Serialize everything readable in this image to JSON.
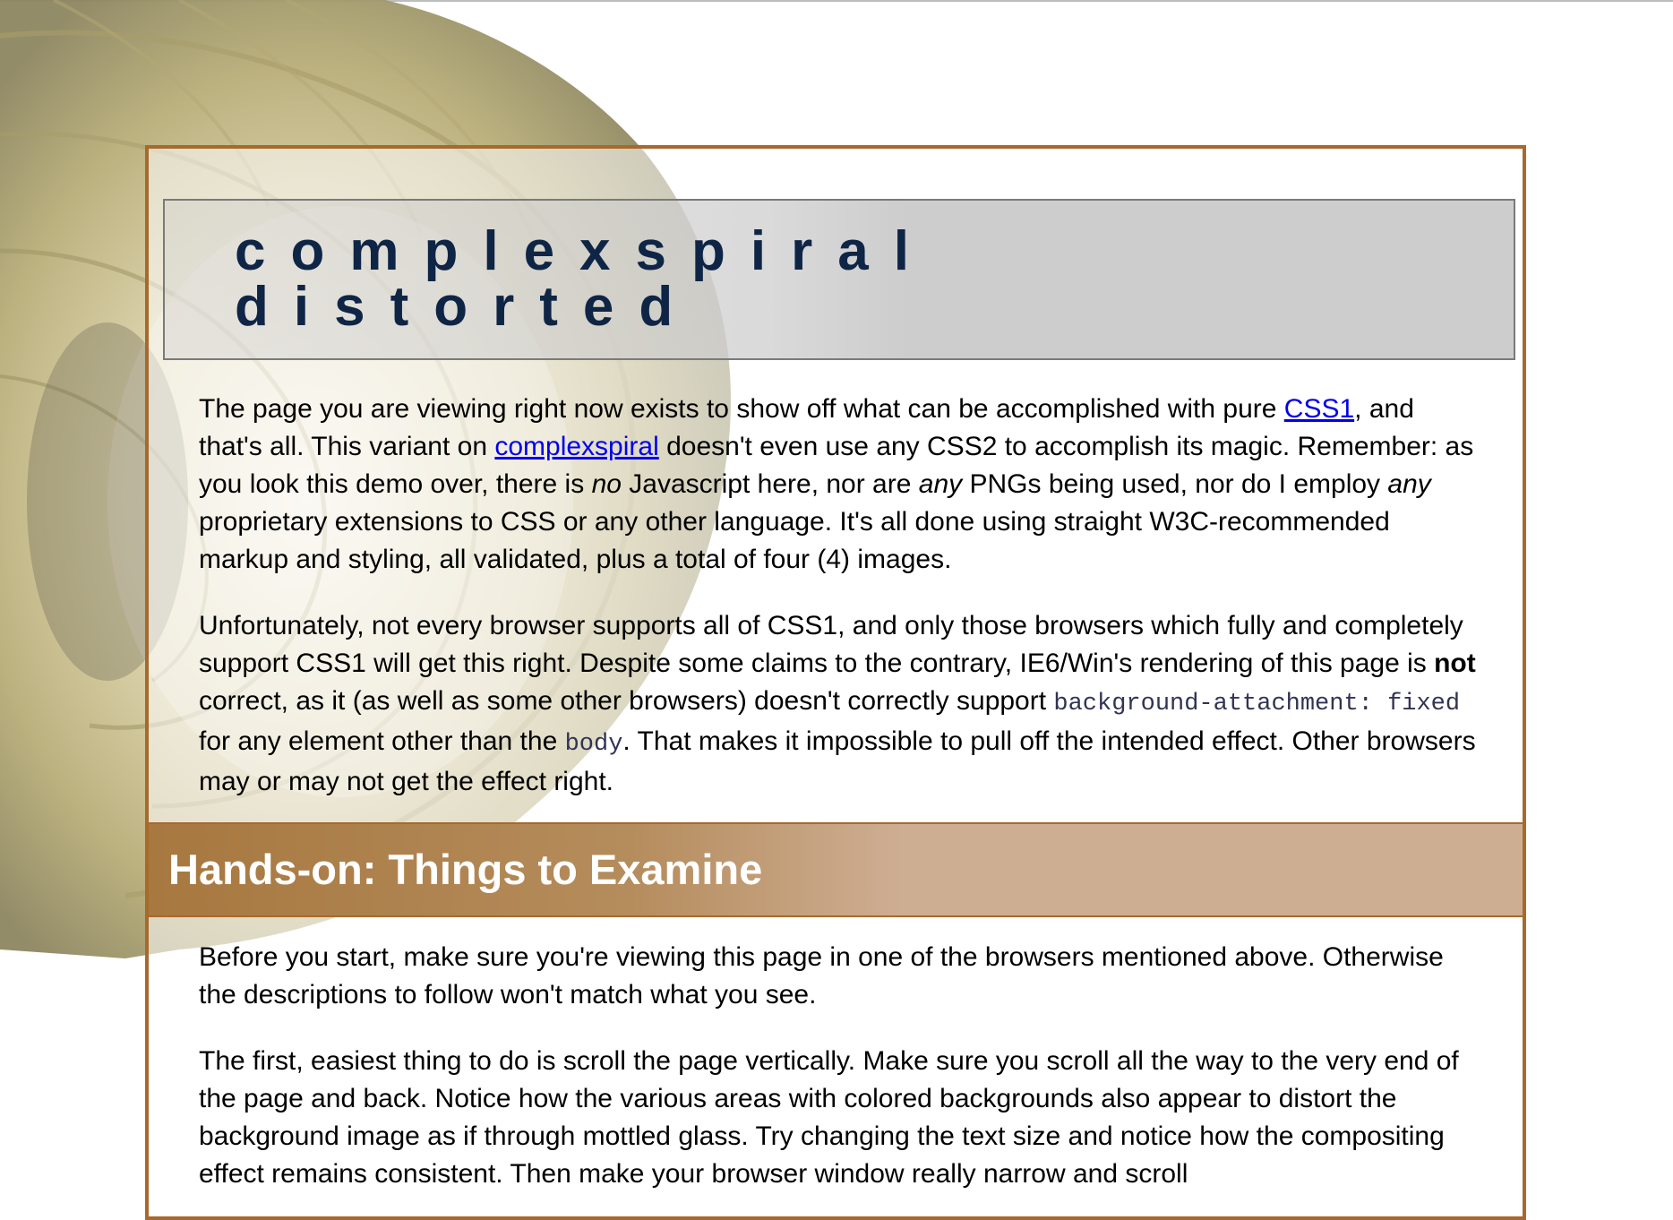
{
  "banner": {
    "line1": "complexspiral",
    "line2": "distorted"
  },
  "intro": {
    "p1_a": "The page you are viewing right now exists to show off what can be accomplished with pure ",
    "p1_link1": "CSS1",
    "p1_b": ", and that's all. This variant on ",
    "p1_link2": "complexspiral",
    "p1_c": " doesn't even use any CSS2 to accomplish its magic. Remember: as you look this demo over, there is ",
    "p1_em1": "no",
    "p1_d": " Javascript here, nor are ",
    "p1_em2": "any",
    "p1_e": " PNGs being used, nor do I employ ",
    "p1_em3": "any",
    "p1_f": " proprietary extensions to CSS or any other language. It's all done using straight W3C-recommended markup and styling, all validated, plus a total of four (4) images.",
    "p2_a": "Unfortunately, not every browser supports all of CSS1, and only those browsers which fully and completely support CSS1 will get this right. Despite some claims to the contrary, IE6/Win's rendering of this page is ",
    "p2_strong": "not",
    "p2_b": " correct, as it (as well as some other browsers) doesn't correctly support ",
    "p2_code1": "background-attachment: fixed",
    "p2_c": " for any element other than the ",
    "p2_code2": "body",
    "p2_d": ". That makes it impossible to pull off the intended effect. Other browsers may or may not get the effect right."
  },
  "section": {
    "heading": "Hands-on: Things to Examine"
  },
  "hands_on": {
    "p1": "Before you start, make sure you're viewing this page in one of the browsers mentioned above. Otherwise the descriptions to follow won't match what you see.",
    "p2": "The first, easiest thing to do is scroll the page vertically. Make sure you scroll all the way to the very end of the page and back. Notice how the various areas with colored backgrounds also appear to distort the background image as if through mottled glass. Try changing the text size and notice how the compositing effect remains consistent. Then make your browser window really narrow and scroll"
  },
  "colors": {
    "border": "#a8692c",
    "banner_text": "#0f2546",
    "section_bg": "#ceae93",
    "link": "#0000ee"
  }
}
